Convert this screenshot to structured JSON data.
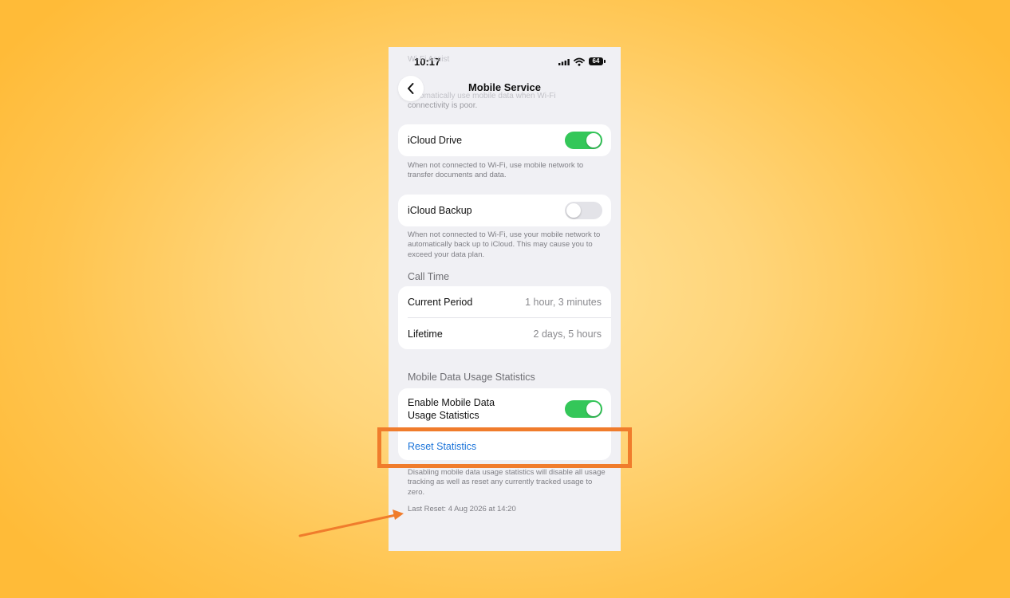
{
  "status_bar": {
    "time": "10:17",
    "battery_level": "64"
  },
  "ghost_header": {
    "faded_title": "Wi-Fi Assist",
    "faded_line_1": "Automatically use mobile data when Wi-Fi",
    "faded_line_2": "connectivity is poor."
  },
  "nav": {
    "title": "Mobile Service",
    "back_icon": "chevron-left-icon"
  },
  "icloud_drive": {
    "label": "iCloud Drive",
    "enabled": true,
    "footnote": "When not connected to Wi-Fi, use mobile network to transfer documents and data."
  },
  "icloud_backup": {
    "label": "iCloud Backup",
    "enabled": false,
    "footnote": "When not connected to Wi-Fi, use your mobile network to automatically back up to iCloud. This may cause you to exceed your data plan."
  },
  "call_time": {
    "header": "Call Time",
    "rows": [
      {
        "label": "Current Period",
        "value": "1 hour, 3 minutes"
      },
      {
        "label": "Lifetime",
        "value": "2 days, 5 hours"
      }
    ]
  },
  "data_usage": {
    "header": "Mobile Data Usage Statistics",
    "enable_label_line_1": "Enable Mobile Data",
    "enable_label_line_2": "Usage Statistics",
    "enabled": true,
    "reset_label": "Reset Statistics",
    "footnote": "Disabling mobile data usage statistics will disable all usage tracking as well as reset any currently tracked usage to zero.",
    "last_reset": "Last Reset: 4 Aug 2026 at 14:20"
  },
  "colors": {
    "accent_link": "#1a73d9",
    "toggle_on": "#34c759",
    "highlight": "#f07c2c",
    "background_gradient": "#ffd06a"
  }
}
